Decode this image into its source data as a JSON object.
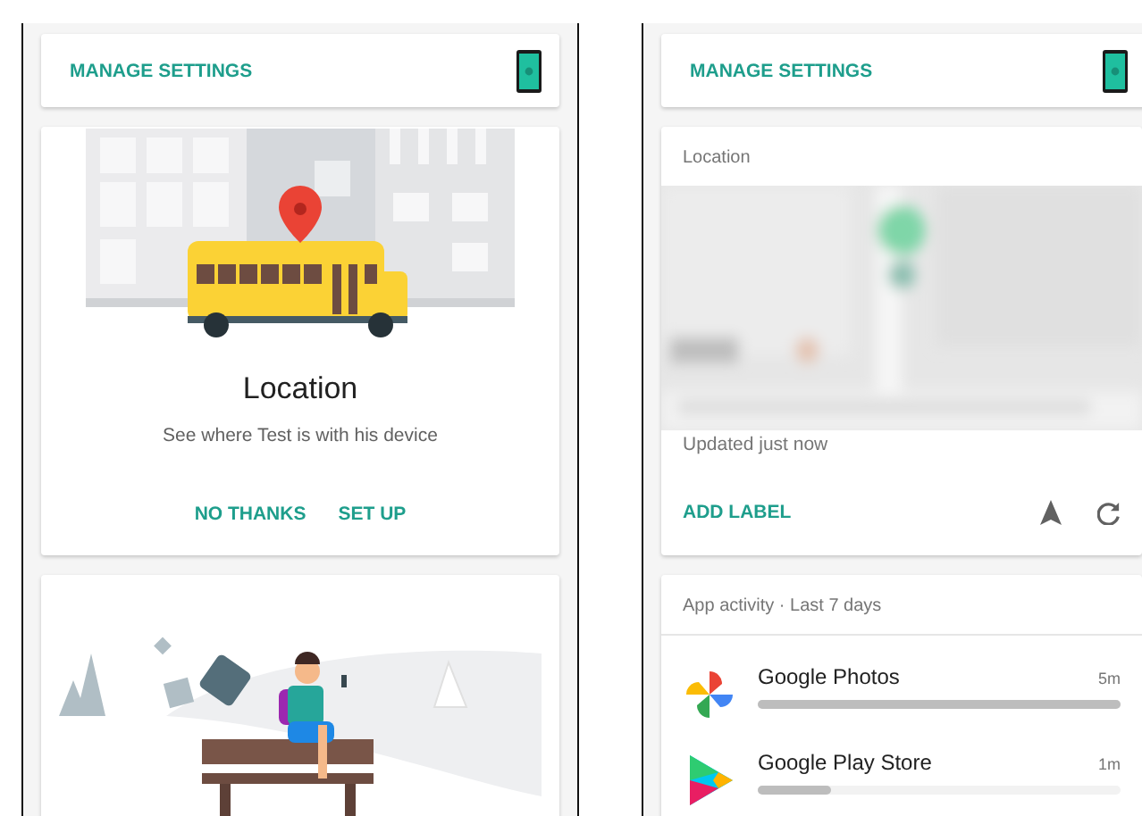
{
  "screens": [
    {
      "header": {
        "label": "MANAGE SETTINGS"
      },
      "cards": [
        {
          "kind": "promo",
          "title": "Location",
          "text": "See where Test is with his device",
          "actions": [
            "NO THANKS",
            "SET UP"
          ]
        },
        {
          "kind": "illustration"
        }
      ]
    },
    {
      "header": {
        "label": "MANAGE SETTINGS"
      },
      "cards": [
        {
          "kind": "location",
          "title": "Location",
          "status": "Updated just now",
          "action": "ADD LABEL"
        },
        {
          "kind": "activity",
          "title": "App activity · Last 7 days",
          "apps": [
            {
              "name": "Google Photos",
              "time": "5m",
              "level": 1
            },
            {
              "name": "Google Play Store",
              "time": "1m",
              "level": 0.2
            }
          ]
        }
      ]
    }
  ]
}
